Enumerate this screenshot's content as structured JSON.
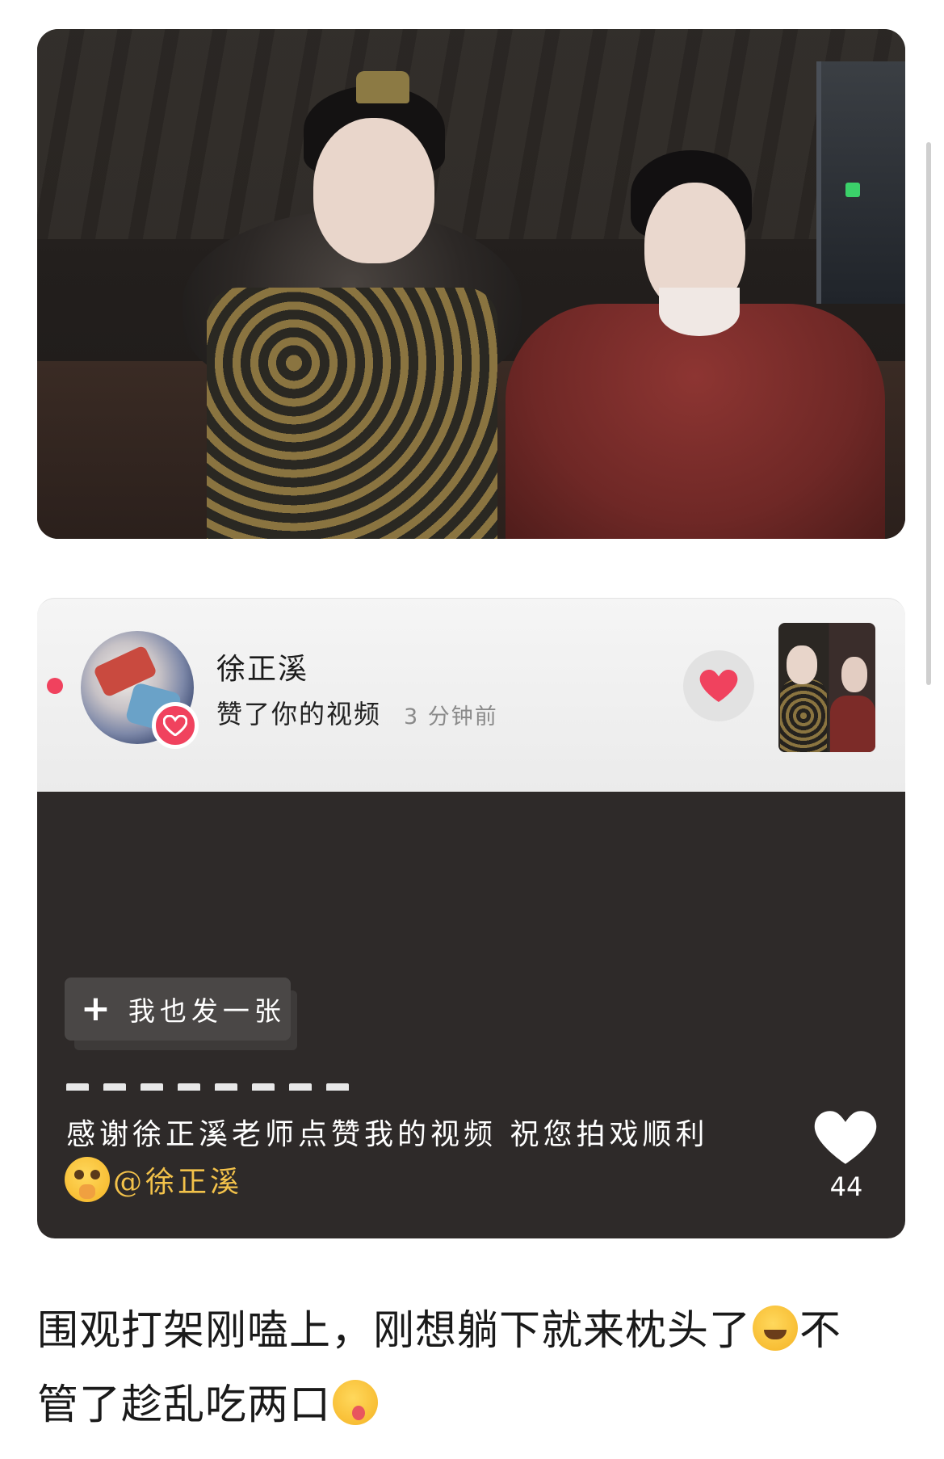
{
  "notification": {
    "user_name": "徐正溪",
    "action": "赞了你的视频",
    "time": "3 分钟前",
    "avatar_icon": "avatar-image",
    "badge_icon": "heart-icon",
    "like_icon": "heart-icon",
    "accent_color": "#f0425e"
  },
  "video": {
    "post_button_label": "我也发一张",
    "post_button_icon": "plus-icon",
    "caption": "感谢徐正溪老师点赞我的视频  祝您拍戏顺利",
    "mention": "@徐正溪",
    "like_count": "44",
    "like_icon": "heart-icon"
  },
  "post": {
    "line1_a": "围观打架刚嗑上，刚想躺下就来枕头了",
    "line1_b": "不",
    "line2": "管了趁乱吃两口"
  }
}
